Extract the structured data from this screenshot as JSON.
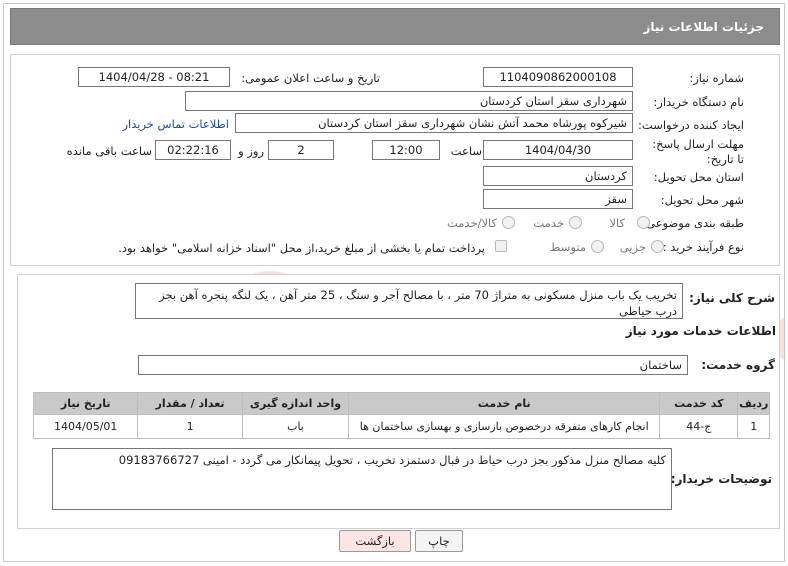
{
  "header": {
    "title": "جزئیات اطلاعات نیاز"
  },
  "fields": {
    "need_number_label": "شماره نیاز:",
    "need_number": "1104090862000108",
    "announce_label": "تاریخ و ساعت اعلان عمومی:",
    "announce_value": "1404/04/28 - 08:21",
    "buyer_label": "نام دستگاه خریدار:",
    "buyer_value": "شهرداری سقز استان کردستان",
    "creator_label": "ایجاد کننده درخواست:",
    "creator_value": "شیرکوه پورشاه محمد آتش نشان شهرداری سقز استان کردستان",
    "contact_link": "اطلاعات تماس خریدار",
    "deadline_label": "مهلت ارسال پاسخ: تا تاریخ:",
    "deadline_date": "1404/04/30",
    "time_label": "ساعت",
    "deadline_time": "12:00",
    "days_value": "2",
    "days_label": "روز و",
    "remaining_value": "02:22:16",
    "remaining_label": "ساعت باقی مانده",
    "province_label": "استان محل تحویل:",
    "province_value": "کردستان",
    "city_label": "شهر محل تحویل:",
    "city_value": "سقز",
    "category_label": "طبقه بندی موضوعی:",
    "category_options": [
      "کالا",
      "خدمت",
      "کالا/خدمت"
    ],
    "process_label": "نوع فرآیند خرید :",
    "process_options": [
      "جزیی",
      "متوسط"
    ],
    "payment_note": "پرداخت تمام یا بخشی از مبلغ خرید،از محل \"اسناد خزانه اسلامی\" خواهد بود."
  },
  "description": {
    "label": "شرح کلی نیاز:",
    "text": "تخریب یک باب منزل مسکونی به متراژ 70 متر ، با مصالح آجر و سنگ ، 25 متر آهن ، یک لنگه پنجره آهن بجز درب حیاطی"
  },
  "services": {
    "section_title": "اطلاعات خدمات مورد نیاز",
    "group_label": "گروه خدمت:",
    "group_value": "ساختمان",
    "columns": [
      "ردیف",
      "کد خدمت",
      "نام خدمت",
      "واحد اندازه گیری",
      "تعداد / مقدار",
      "تاریخ نیاز"
    ],
    "rows": [
      [
        "1",
        "ج-44",
        "انجام کارهای متفرقه درخصوص بازسازی و بهسازی ساختمان ها",
        "باب",
        "1",
        "1404/05/01"
      ]
    ]
  },
  "buyer_notes": {
    "label": "توضیحات خریدار:",
    "text": "کلیه مصالح منزل مذکور بجز درب حیاط در قبال دستمزد تخریب ، تحویل پیمانکار می گردد - امینی 09183766727"
  },
  "buttons": {
    "print": "چاپ",
    "back": "بازگشت"
  },
  "colors": {
    "header": "#8c8c8c",
    "link": "#1a4fa0",
    "back_button": "#fde5e5",
    "watermark": "#f3d0d0"
  }
}
